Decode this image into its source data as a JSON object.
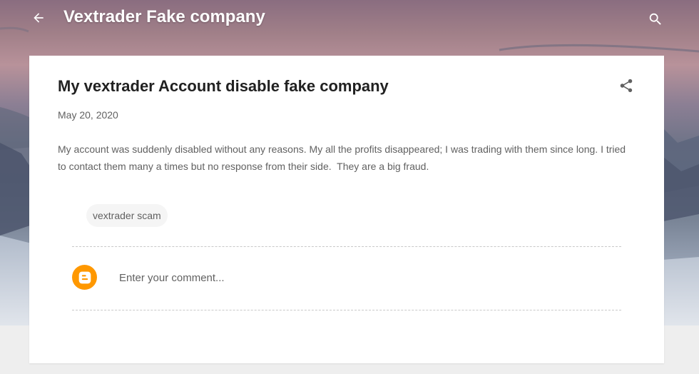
{
  "header": {
    "blog_title": "Vextrader Fake company",
    "back_icon": "arrow-back-icon",
    "search_icon": "search-icon"
  },
  "post": {
    "title": "My vextrader Account disable fake company",
    "date": "May 20, 2020",
    "body": "My account was suddenly disabled without any reasons. My all the profits disappeared; I was trading with them since long. I tried to contact them many a times but no response from their side.  They are a big fraud.",
    "share_icon": "share-icon",
    "labels": [
      "vextrader scam"
    ]
  },
  "comments": {
    "placeholder": "Enter your comment...",
    "avatar_icon": "blogger-logo-icon"
  },
  "colors": {
    "accent_orange": "#ff9800",
    "text_dark": "#212121",
    "text_muted": "#616161",
    "page_bg": "#eeeeee"
  }
}
